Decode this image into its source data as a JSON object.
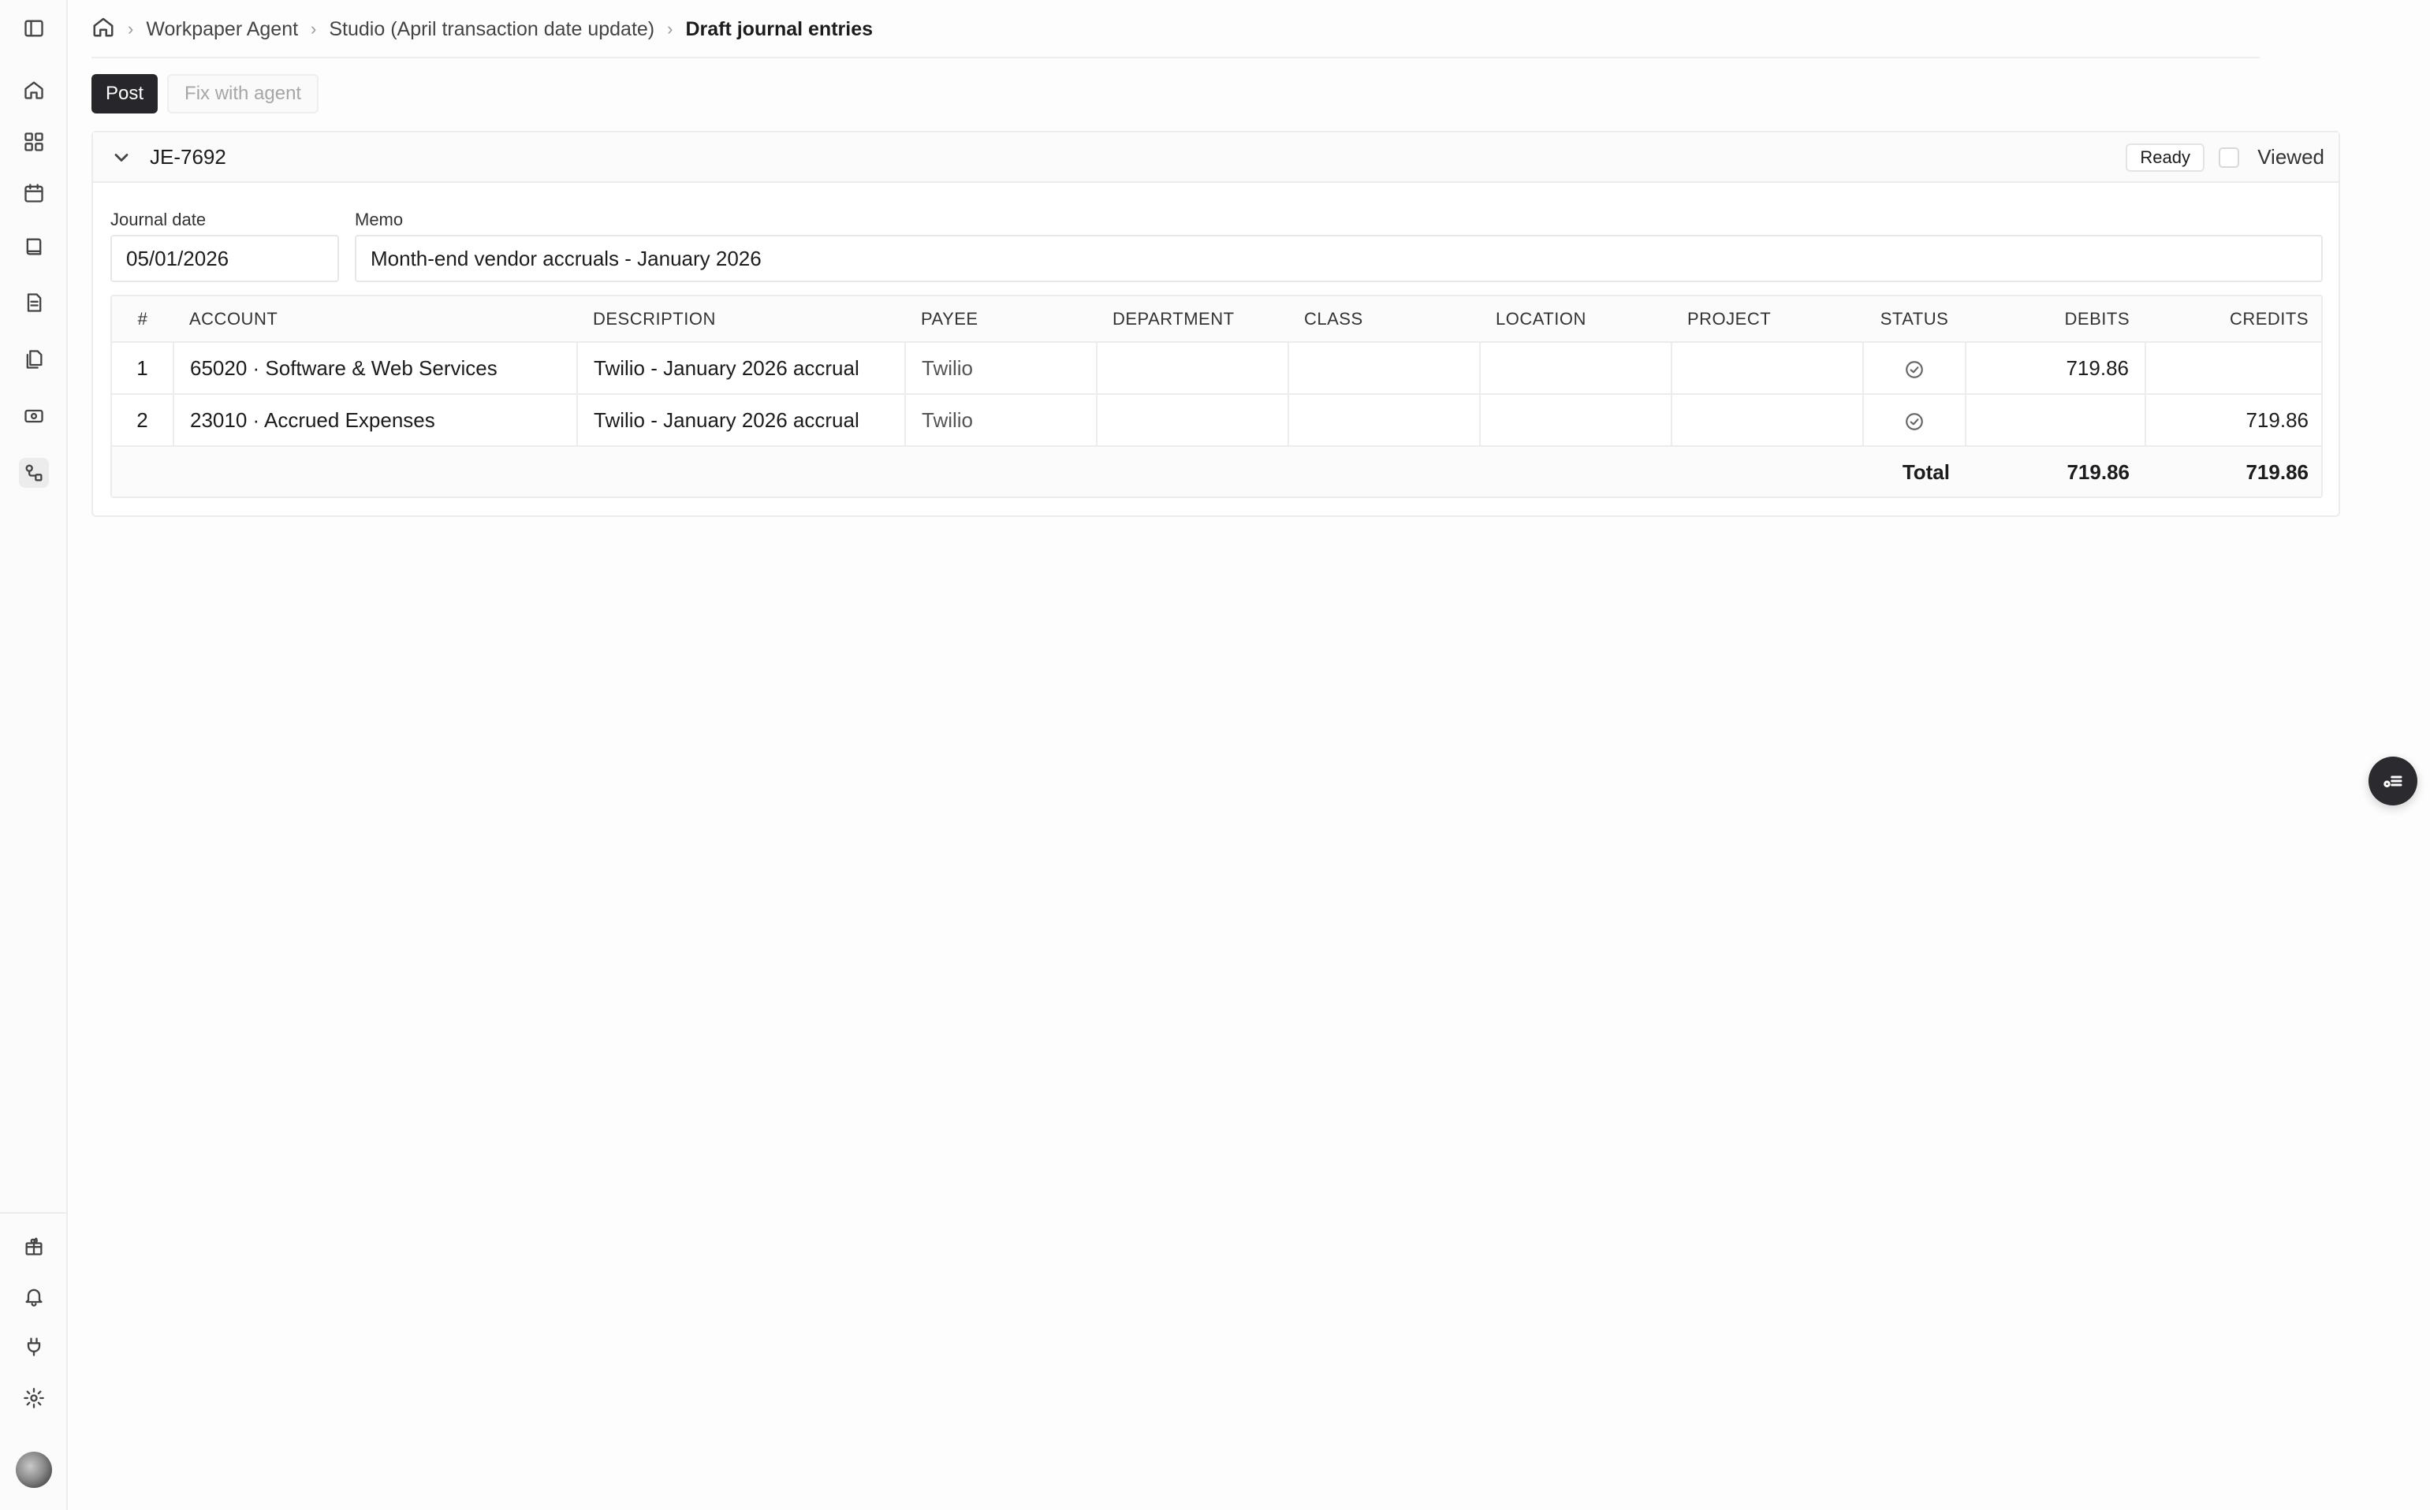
{
  "breadcrumb": {
    "items": [
      "Workpaper Agent",
      "Studio (April transaction date update)"
    ],
    "current": "Draft journal entries"
  },
  "toolbar": {
    "post_label": "Post",
    "fix_label": "Fix with agent"
  },
  "journal_entry": {
    "id": "JE-7692",
    "status_badge": "Ready",
    "viewed_label": "Viewed",
    "journal_date_label": "Journal date",
    "journal_date": "05/01/2026",
    "memo_label": "Memo",
    "memo": "Month-end vendor accruals - January 2026"
  },
  "lines_table": {
    "columns": [
      "#",
      "ACCOUNT",
      "DESCRIPTION",
      "PAYEE",
      "DEPARTMENT",
      "CLASS",
      "LOCATION",
      "PROJECT",
      "STATUS",
      "DEBITS",
      "CREDITS"
    ],
    "rows": [
      {
        "num": "1",
        "account": "65020 · Software & Web Services",
        "description": "Twilio - January 2026 accrual",
        "payee": "Twilio",
        "department": "",
        "class": "",
        "location": "",
        "project": "",
        "status": "check-circle-icon",
        "debit": "719.86",
        "credit": ""
      },
      {
        "num": "2",
        "account": "23010 · Accrued Expenses",
        "description": "Twilio - January 2026 accrual",
        "payee": "Twilio",
        "department": "",
        "class": "",
        "location": "",
        "project": "",
        "status": "check-circle-icon",
        "debit": "",
        "credit": "719.86"
      }
    ],
    "total_label": "Total",
    "total_debits": "719.86",
    "total_credits": "719.86"
  },
  "sidebar": {
    "top_icons": [
      "sidebar-toggle-icon",
      "home-icon",
      "dashboard-icon",
      "calendar-icon",
      "book-icon",
      "document-icon",
      "files-icon",
      "money-icon",
      "workflow-icon"
    ],
    "bottom_icons": [
      "gift-icon",
      "bell-icon",
      "plug-icon",
      "gear-icon",
      "avatar"
    ]
  },
  "fab_icon": "task-list-icon"
}
